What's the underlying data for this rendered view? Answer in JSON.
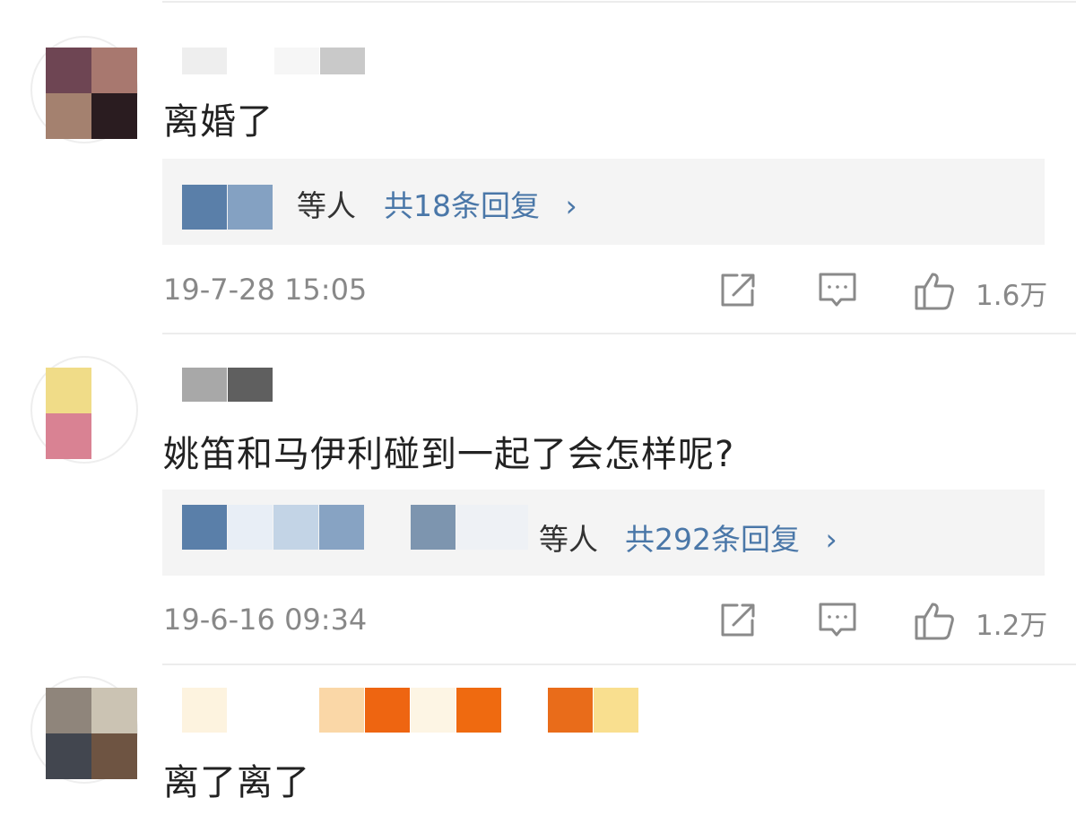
{
  "comments": [
    {
      "text": "离婚了",
      "reply_etc": "等人",
      "reply_total": "共18条回复",
      "chevron": "›",
      "timestamp": "19-7-28 15:05",
      "like_count": "1.6万"
    },
    {
      "text": "姚笛和马伊利碰到一起了会怎样呢?",
      "reply_etc": "等人",
      "reply_total": "共292条回复",
      "chevron": "›",
      "timestamp": "19-6-16 09:34",
      "like_count": "1.2万"
    },
    {
      "text": "离了离了"
    }
  ],
  "icons": {
    "share": "share-icon",
    "comment": "comment-icon",
    "like": "thumbs-up-icon",
    "chevron": "chevron-right-icon"
  },
  "colors": {
    "link_blue": "#4a77a8",
    "meta_gray": "#888888",
    "reply_bg": "#f4f4f4"
  }
}
